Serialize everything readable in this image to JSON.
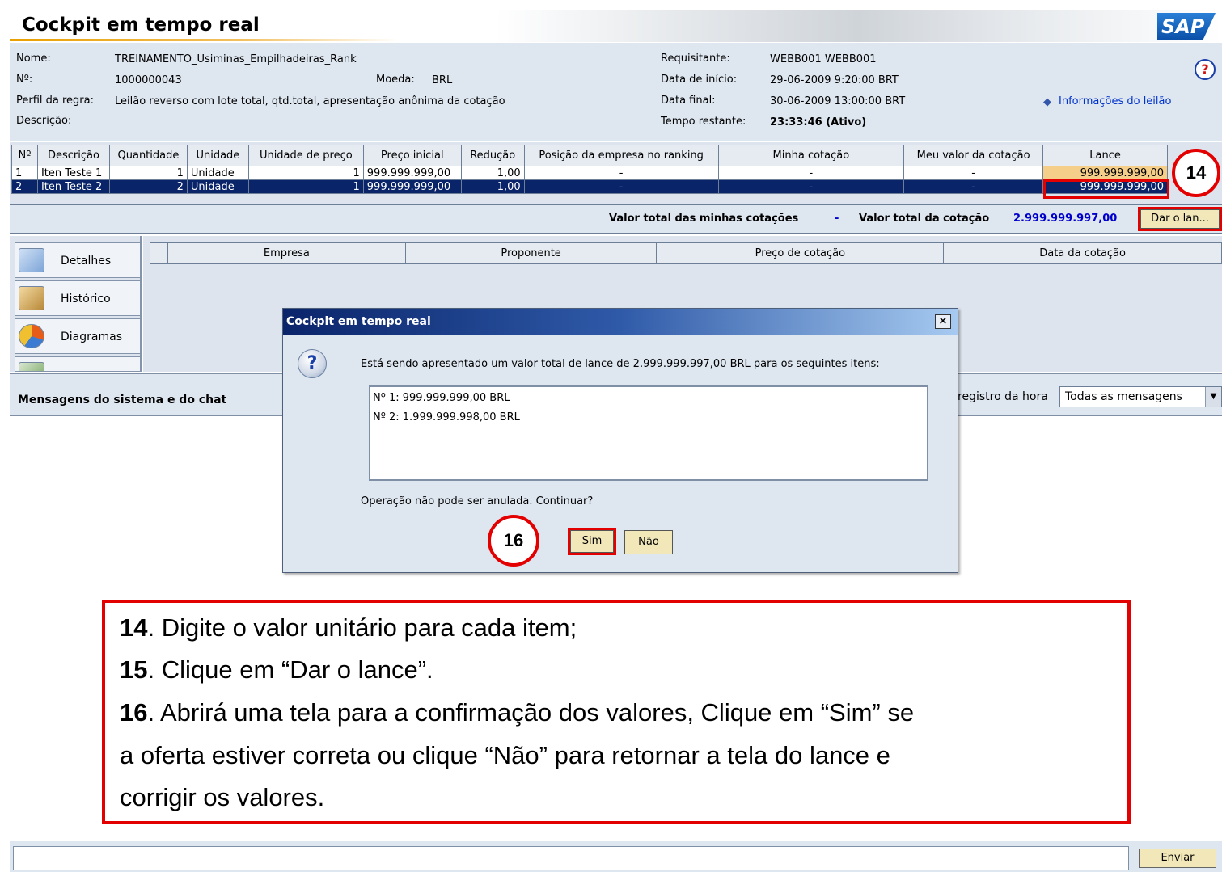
{
  "window": {
    "title": "Cockpit em tempo real",
    "logo": "SAP"
  },
  "header": {
    "nome_label": "Nome:",
    "nome_value": "TREINAMENTO_Usiminas_Empilhadeiras_Rank",
    "numero_label": "Nº:",
    "numero_value": "1000000043",
    "moeda_label": "Moeda:",
    "moeda_value": "BRL",
    "perfil_label": "Perfil da regra:",
    "perfil_value": "Leilão reverso com lote total, qtd.total, apresentação anônima da cotação",
    "descricao_label": "Descrição:",
    "requisitante_label": "Requisitante:",
    "requisitante_value": "WEBB001 WEBB001",
    "inicio_label": "Data de início:",
    "inicio_value": "29-06-2009 9:20:00 BRT",
    "final_label": "Data final:",
    "final_value": "30-06-2009 13:00:00 BRT",
    "restante_label": "Tempo restante:",
    "restante_value": "23:33:46 (Ativo)",
    "info_link": "Informações do leilão",
    "help_icon": "question-icon"
  },
  "items_table": {
    "columns": [
      "Nº",
      "Descrição",
      "Quantidade",
      "Unidade",
      "Unidade de preço",
      "Preço inicial",
      "Redução",
      "Posição da empresa no ranking",
      "Minha cotação",
      "Meu valor da cotação",
      "Lance"
    ],
    "rows": [
      {
        "no": "1",
        "descricao": "Iten Teste 1",
        "quantidade": "1",
        "unidade": "Unidade",
        "unidade_preco": "1",
        "preco_inicial": "999.999.999,00",
        "reducao": "1,00",
        "posicao": "-",
        "minha_cotacao": "-",
        "meu_valor": "-",
        "lance": "999.999.999,00",
        "selected": false
      },
      {
        "no": "2",
        "descricao": "Iten Teste 2",
        "quantidade": "2",
        "unidade": "Unidade",
        "unidade_preco": "1",
        "preco_inicial": "999.999.999,00",
        "reducao": "1,00",
        "posicao": "-",
        "minha_cotacao": "-",
        "meu_valor": "-",
        "lance": "999.999.999,00",
        "selected": true
      }
    ]
  },
  "totals": {
    "minhas_label": "Valor total das minhas cotações",
    "minhas_value": "-",
    "cotacao_label": "Valor total da cotação",
    "cotacao_value": "2.999.999.997,00",
    "bid_button": "Dar o lan..."
  },
  "nav": {
    "items": [
      {
        "label": "Detalhes",
        "icon": "magnifier-icon"
      },
      {
        "label": "Histórico",
        "icon": "history-icon"
      },
      {
        "label": "Diagramas",
        "icon": "pie-chart-icon"
      },
      {
        "label": "",
        "icon": "document-icon"
      }
    ]
  },
  "history_table": {
    "columns": [
      "Empresa",
      "Proponente",
      "Preço de cotação",
      "Data da cotação"
    ]
  },
  "messages": {
    "title": "Mensagens do sistema e do chat",
    "registro_label": "registro da hora",
    "filter_value": "Todas as mensagens",
    "send_button": "Enviar"
  },
  "dialog": {
    "title": "Cockpit em tempo real",
    "close": "×",
    "message": "Está sendo apresentado um valor total de lance de 2.999.999.997,00 BRL para os seguintes itens:",
    "lines": [
      "Nº 1:  999.999.999,00 BRL",
      "Nº 2:  1.999.999.998,00 BRL"
    ],
    "warning": "Operação não pode ser anulada. Continuar?",
    "yes": "Sim",
    "no": "Não"
  },
  "callouts": {
    "c14": "14",
    "c16": "16"
  },
  "instructions": {
    "l1_num": "14",
    "l1_text": ". Digite o valor unitário para cada item;",
    "l2_num": "15",
    "l2_text": ". Clique em “Dar o lance”.",
    "l3_num": "16",
    "l3_text": ". Abrirá uma tela para a confirmação dos valores, Clique em “Sim” se",
    "l4_text": "a oferta estiver correta ou clique “Não” para retornar a tela do lance e",
    "l5_text": "corrigir os valores."
  },
  "colors": {
    "accent_red": "#e30000",
    "selection": "#0a246a",
    "panel": "#dee6f0",
    "button": "#f2e7b8"
  }
}
